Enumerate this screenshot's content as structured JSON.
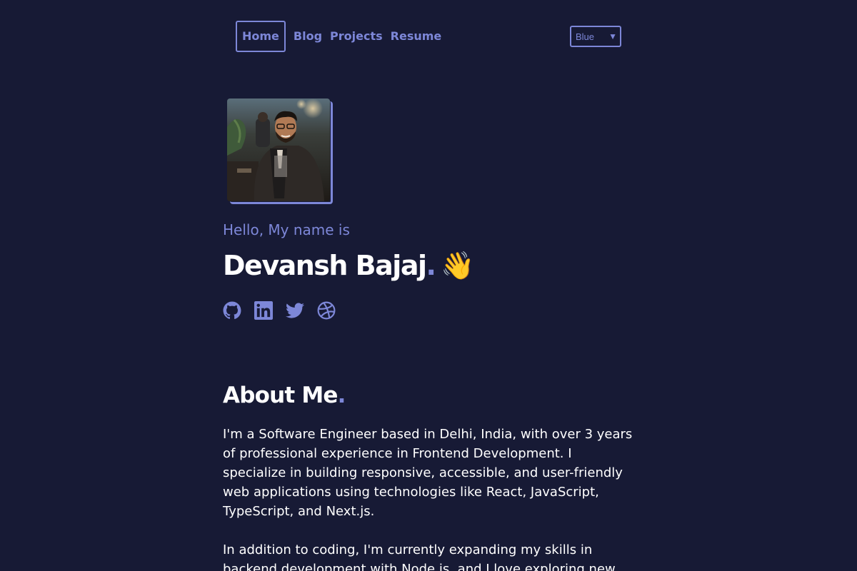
{
  "nav": {
    "items": [
      {
        "label": "Home",
        "active": true
      },
      {
        "label": "Blog",
        "active": false
      },
      {
        "label": "Projects",
        "active": false
      },
      {
        "label": "Resume",
        "active": false
      }
    ],
    "theme_select": {
      "value": "Blue",
      "arrow": "▼"
    }
  },
  "hero": {
    "greeting": "Hello, My name is",
    "name": "Devansh Bajaj",
    "name_dot": ".",
    "wave_emoji": "👋",
    "avatar": "profile-photo",
    "socials": [
      {
        "icon": "github-icon"
      },
      {
        "icon": "linkedin-icon"
      },
      {
        "icon": "twitter-icon"
      },
      {
        "icon": "dribbble-icon"
      }
    ]
  },
  "about": {
    "title": "About Me",
    "title_dot": ".",
    "paragraphs": [
      "I'm a Software Engineer based in Delhi, India, with over 3 years of professional experience in Frontend Development. I specialize in building responsive, accessible, and user-friendly web applications using technologies like React, JavaScript, TypeScript, and Next.js.",
      "In addition to coding, I'm currently expanding my skills in backend development with Node.js, and I love exploring new"
    ]
  },
  "colors": {
    "background": "#171a35",
    "accent": "#7d87d8",
    "text": "#ffffff"
  }
}
